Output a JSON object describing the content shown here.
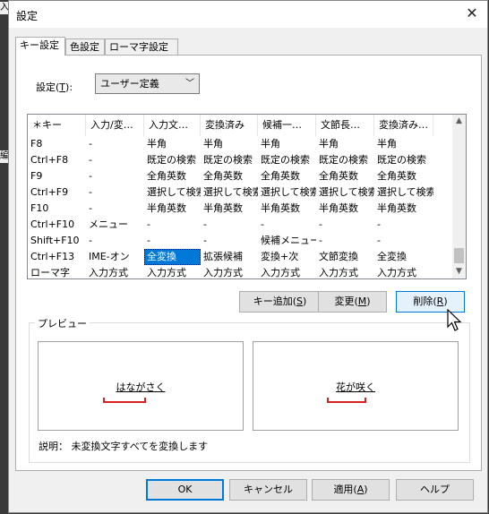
{
  "background": {
    "strip_texts": [
      "入",
      "編"
    ]
  },
  "window": {
    "title": "設定",
    "close_icon": "close-icon"
  },
  "tabs": [
    {
      "label": "キー設定",
      "active": true
    },
    {
      "label": "色設定",
      "active": false
    },
    {
      "label": "ローマ字設定",
      "active": false
    }
  ],
  "settings": {
    "label_prefix": "設定(",
    "label_accel": "T",
    "label_suffix": "):",
    "value": "ユーザー定義"
  },
  "table": {
    "columns": [
      "＊キー",
      "入力/変…",
      "入力文…",
      "変換済み",
      "候補一…",
      "文節長…",
      "変換済み…"
    ],
    "rows": [
      [
        "F8",
        "-",
        "半角",
        "半角",
        "半角",
        "半角",
        "半角"
      ],
      [
        "Ctrl+F8",
        "-",
        "既定の検索",
        "既定の検索",
        "既定の検索",
        "既定の検索",
        "既定の検索"
      ],
      [
        "F9",
        "-",
        "全角英数",
        "全角英数",
        "全角英数",
        "全角英数",
        "全角英数"
      ],
      [
        "Ctrl+F9",
        "-",
        "選択して検索",
        "選択して検索",
        "選択して検索",
        "選択して検索",
        "選択して検索"
      ],
      [
        "F10",
        "-",
        "半角英数",
        "半角英数",
        "半角英数",
        "半角英数",
        "半角英数"
      ],
      [
        "Ctrl+F10",
        "メニュー",
        "-",
        "-",
        "-",
        "-",
        "-"
      ],
      [
        "Shift+F10",
        "-",
        "-",
        "-",
        "候補メニュー",
        "-",
        "-"
      ],
      [
        "Ctrl+F13",
        "IME-オン",
        "全変換",
        "拡張候補",
        "変換+次",
        "文節変換",
        "全変換"
      ],
      [
        "ローマ字",
        "入力方式",
        "入力方式",
        "入力方式",
        "入力方式",
        "入力方式",
        "入力方式"
      ]
    ],
    "selected": {
      "row": 7,
      "col": 2
    }
  },
  "actions": {
    "add": {
      "prefix": "キー追加(",
      "accel": "S",
      "suffix": ")"
    },
    "change": {
      "prefix": "変更(",
      "accel": "M",
      "suffix": ")"
    },
    "delete": {
      "prefix": "削除(",
      "accel": "R",
      "suffix": ")"
    }
  },
  "preview": {
    "label": "プレビュー",
    "left_text": "はながさく",
    "right_text": "花が咲く",
    "bracket_color": "#d92020"
  },
  "description": {
    "label": "説明：",
    "text": "未変換文字すべてを変換します"
  },
  "footer": {
    "ok": "OK",
    "cancel": "キャンセル",
    "apply": {
      "prefix": "適用(",
      "accel": "A",
      "suffix": ")"
    },
    "help": "ヘルプ"
  },
  "colors": {
    "accent": "#0078d7",
    "selection": "#0078d7"
  }
}
